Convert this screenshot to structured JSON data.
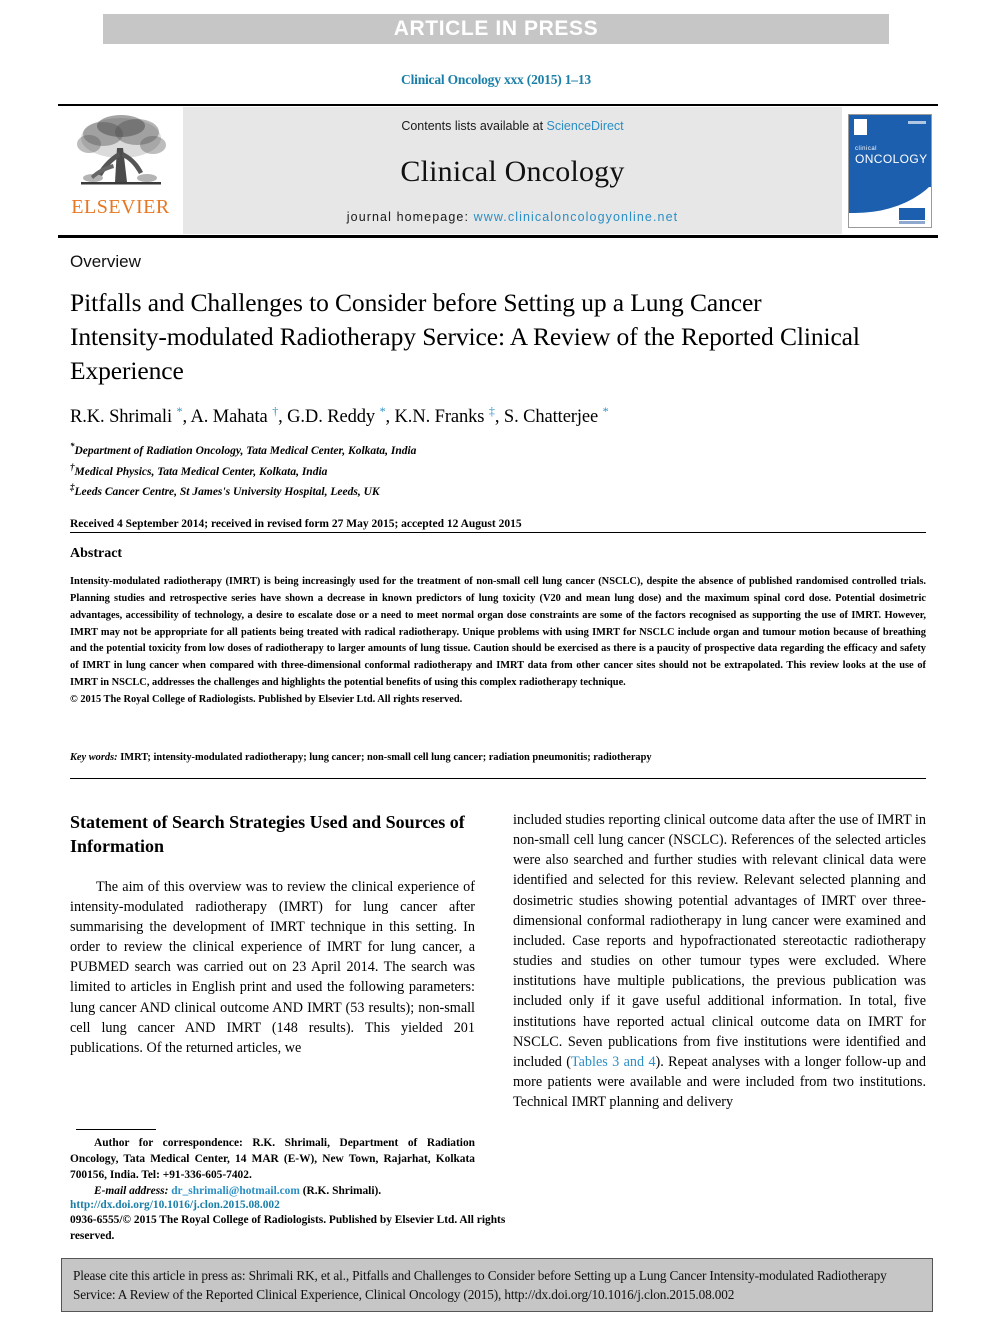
{
  "banner": {
    "text": "ARTICLE IN PRESS"
  },
  "journal_ref": "Clinical Oncology xxx (2015) 1–13",
  "masthead": {
    "publisher_name": "ELSEVIER",
    "contents_prefix": "Contents lists available at ",
    "contents_link": "ScienceDirect",
    "journal_title": "Clinical Oncology",
    "homepage_prefix": "journal homepage: ",
    "homepage_url": "www.clinicaloncologyonline.net",
    "cover": {
      "line1": "clinical",
      "line2": "ONCOLOGY"
    },
    "accent_link_color": "#2b8fc4",
    "elsevier_orange": "#e87722",
    "panel_gray": "#e7e7e7"
  },
  "article": {
    "type_label": "Overview",
    "title": "Pitfalls and Challenges to Consider before Setting up a Lung Cancer Intensity-modulated Radiotherapy Service: A Review of the Reported Clinical Experience",
    "authors_html": "R.K. Shrimali <sup>*</sup>, A. Mahata <sup>†</sup>, G.D. Reddy <sup>*</sup>, K.N. Franks <sup>‡</sup>, S. Chatterjee <sup>*</sup>",
    "affiliations": [
      {
        "marker": "*",
        "text": "Department of Radiation Oncology, Tata Medical Center, Kolkata, India"
      },
      {
        "marker": "†",
        "text": "Medical Physics, Tata Medical Center, Kolkata, India"
      },
      {
        "marker": "‡",
        "text": "Leeds Cancer Centre, St James's University Hospital, Leeds, UK"
      }
    ],
    "history": "Received 4 September 2014; received in revised form 27 May 2015; accepted 12 August 2015"
  },
  "abstract": {
    "heading": "Abstract",
    "body": "Intensity-modulated radiotherapy (IMRT) is being increasingly used for the treatment of non-small cell lung cancer (NSCLC), despite the absence of published randomised controlled trials. Planning studies and retrospective series have shown a decrease in known predictors of lung toxicity (V20 and mean lung dose) and the maximum spinal cord dose. Potential dosimetric advantages, accessibility of technology, a desire to escalate dose or a need to meet normal organ dose constraints are some of the factors recognised as supporting the use of IMRT. However, IMRT may not be appropriate for all patients being treated with radical radiotherapy. Unique problems with using IMRT for NSCLC include organ and tumour motion because of breathing and the potential toxicity from low doses of radiotherapy to larger amounts of lung tissue. Caution should be exercised as there is a paucity of prospective data regarding the efficacy and safety of IMRT in lung cancer when compared with three-dimensional conformal radiotherapy and IMRT data from other cancer sites should not be extrapolated. This review looks at the use of IMRT in NSCLC, addresses the challenges and highlights the potential benefits of using this complex radiotherapy technique.",
    "copyright": "© 2015 The Royal College of Radiologists. Published by Elsevier Ltd. All rights reserved.",
    "keywords_label": "Key words:",
    "keywords": "IMRT; intensity-modulated radiotherapy; lung cancer; non-small cell lung cancer; radiation pneumonitis; radiotherapy"
  },
  "body": {
    "left": {
      "heading": "Statement of Search Strategies Used and Sources of Information",
      "paragraph": "The aim of this overview was to review the clinical experience of intensity-modulated radiotherapy (IMRT) for lung cancer after summarising the development of IMRT technique in this setting. In order to review the clinical experience of IMRT for lung cancer, a PUBMED search was carried out on 23 April 2014. The search was limited to articles in English print and used the following parameters: lung cancer AND clinical outcome AND IMRT (53 results); non-small cell lung cancer AND IMRT (148 results). This yielded 201 publications. Of the returned articles, we"
    },
    "right": {
      "paragraph_part1": "included studies reporting clinical outcome data after the use of IMRT in non-small cell lung cancer (NSCLC). References of the selected articles were also searched and further studies with relevant clinical data were identified and selected for this review. Relevant selected planning and dosimetric studies showing potential advantages of IMRT over three-dimensional conformal radiotherapy in lung cancer were examined and included. Case reports and hypofractionated stereotactic radiotherapy studies and studies on other tumour types were excluded. Where institutions have multiple publications, the previous publication was included only if it gave useful additional information. In total, five institutions have reported actual clinical outcome data on IMRT for NSCLC. Seven publications from five institutions were identified and included (",
      "link_text": "Tables 3 and 4",
      "paragraph_part2": "). Repeat analyses with a longer follow-up and more patients were available and were included from two institutions. Technical IMRT planning and delivery"
    }
  },
  "footnotes": {
    "correspondence": "Author for correspondence: R.K. Shrimali, Department of Radiation Oncology, Tata Medical Center, 14 MAR (E-W), New Town, Rajarhat, Kolkata 700156, India. Tel: +91-336-605-7402.",
    "email_label": "E-mail address:",
    "email": "dr_shrimali@hotmail.com",
    "email_suffix": "(R.K. Shrimali).",
    "doi_url": "http://dx.doi.org/10.1016/j.clon.2015.08.002",
    "issn_line": "0936-6555/© 2015 The Royal College of Radiologists. Published by Elsevier Ltd. All rights reserved."
  },
  "citation_footer": {
    "text": "Please cite this article in press as: Shrimali RK, et al., Pitfalls and Challenges to Consider before Setting up a Lung Cancer Intensity-modulated Radiotherapy Service: A Review of the Reported Clinical Experience, Clinical Oncology (2015), http://dx.doi.org/10.1016/j.clon.2015.08.002"
  }
}
